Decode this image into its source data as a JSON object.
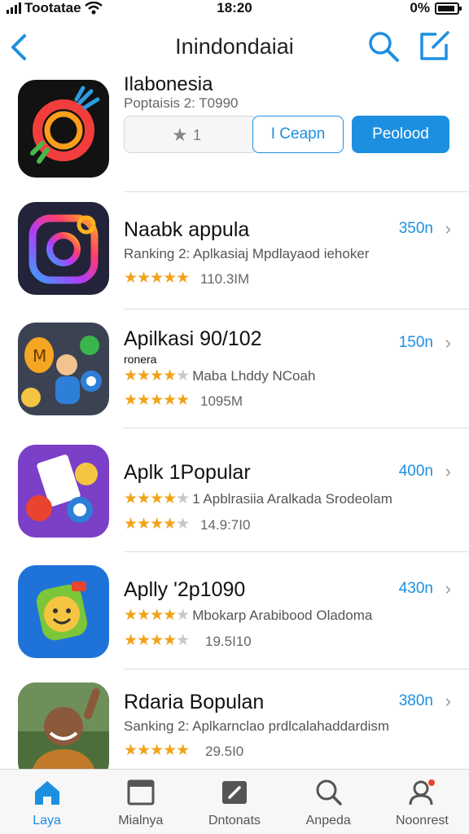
{
  "status_bar": {
    "carrier": "Tootatae",
    "time": "18:20",
    "battery": "0%"
  },
  "header": {
    "title": "Inindondaiai"
  },
  "featured": {
    "name": "Ilabonesia",
    "subtitle": "Poptaisis 2: T0990",
    "rating_value": "1",
    "outline_button": "I Ceapn",
    "primary_button": "Peolood"
  },
  "apps": [
    {
      "name": "Naabk appula",
      "subtitle": "Ranking 2: Aplkasiaj Mpdlayaod iehoker",
      "size": "110.3IM",
      "price": "350n",
      "rating": 5
    },
    {
      "name": "Apilkasi 90/102",
      "extra": "ronera",
      "rating_text": "Maba Lhddy NCoah",
      "size": "1095M",
      "price": "150n",
      "rating": 4.5
    },
    {
      "name": "Aplk 1Popular",
      "rating_text": "1 Apblrasiia Aralkada Srodeolam",
      "size": "14.9:7I0",
      "price": "400n",
      "rating": 4
    },
    {
      "name": "Aplly '2p1090",
      "rating_text": "Mbokarp Arabibood Oladoma",
      "size": "19.5I10",
      "price": "430n",
      "rating": 4
    },
    {
      "name": "Rdaria Bopulan",
      "subtitle": "Sanking 2: Aplkarnclao prdlcalahaddardism",
      "size": "29.5I0",
      "price": "380n",
      "rating": 5
    }
  ],
  "tabs": [
    {
      "label": "Laya",
      "icon": "home-icon",
      "active": true
    },
    {
      "label": "Mialnya",
      "icon": "window-icon",
      "active": false
    },
    {
      "label": "Dntonats",
      "icon": "pencil-square-icon",
      "active": false
    },
    {
      "label": "Anpeda",
      "icon": "search-icon",
      "active": false
    },
    {
      "label": "Noonrest",
      "icon": "person-icon",
      "active": false
    }
  ],
  "colors": {
    "accent": "#1d8fe1",
    "star": "#f0a319"
  }
}
